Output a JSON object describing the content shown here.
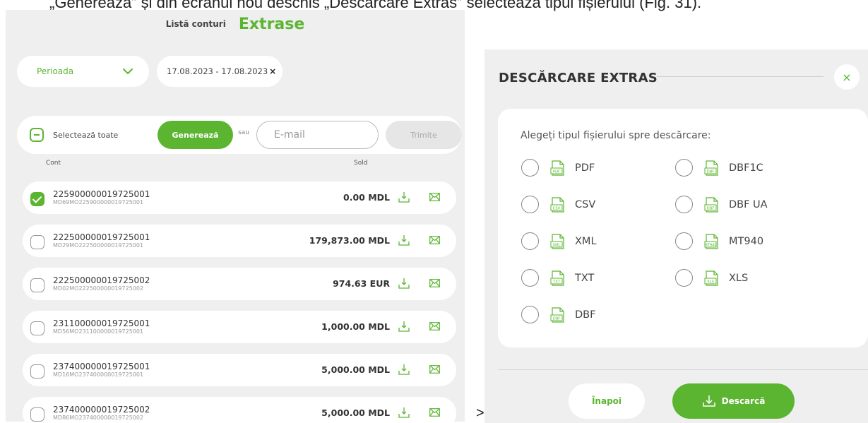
{
  "caption": "„Generează” și din ecranul nou deschis „Descărcare Extras” selectează tipul fișierului (Fig. 31).",
  "left": {
    "tabs": {
      "list": "Listă conturi",
      "active": "Extrase"
    },
    "filters": {
      "period_label": "Perioada",
      "date_range": "17.08.2023 - 17.08.2023",
      "clear": "×"
    },
    "actions": {
      "select_all": "Selectează toate",
      "generate": "Generează",
      "or": "sau",
      "email_placeholder": "E-mail",
      "send": "Trimite"
    },
    "columns": {
      "account": "Cont",
      "balance": "Sold"
    },
    "accounts": [
      {
        "number": "225900000019725001",
        "iban": "MD69MO225900000019725001",
        "balance": "0.00 MDL",
        "checked": true
      },
      {
        "number": "222500000019725001",
        "iban": "MD29MO222500000019725001",
        "balance": "179,873.00 MDL",
        "checked": false
      },
      {
        "number": "222500000019725002",
        "iban": "MD02MO222500000019725002",
        "balance": "974.63 EUR",
        "checked": false
      },
      {
        "number": "231100000019725001",
        "iban": "MD56MO231100000019725001",
        "balance": "1,000.00 MDL",
        "checked": false
      },
      {
        "number": "237400000019725001",
        "iban": "MD16MO237400000019725001",
        "balance": "5,000.00 MDL",
        "checked": false
      },
      {
        "number": "237400000019725002",
        "iban": "MD86MO237400000019725002",
        "balance": "5,000.00 MDL",
        "checked": false
      }
    ]
  },
  "arrow": ">",
  "dialog": {
    "title": "DESCĂRCARE EXTRAS",
    "close": "×",
    "prompt": "Alegeți tipul fișierului spre descărcare:",
    "file_types": [
      {
        "label": "PDF",
        "icon": "PDF"
      },
      {
        "label": "DBF1C",
        "icon": "DBF"
      },
      {
        "label": "CSV",
        "icon": "CSV"
      },
      {
        "label": "DBF UA",
        "icon": "DBF"
      },
      {
        "label": "XML",
        "icon": "XML"
      },
      {
        "label": "MT940",
        "icon": "MT940"
      },
      {
        "label": "TXT",
        "icon": "TXT"
      },
      {
        "label": "XLS",
        "icon": "XLS"
      },
      {
        "label": "DBF",
        "icon": "DBF"
      }
    ],
    "back": "Înapoi",
    "download": "Descarcă"
  },
  "colors": {
    "accent": "#5cb531",
    "panel": "#efefef"
  }
}
